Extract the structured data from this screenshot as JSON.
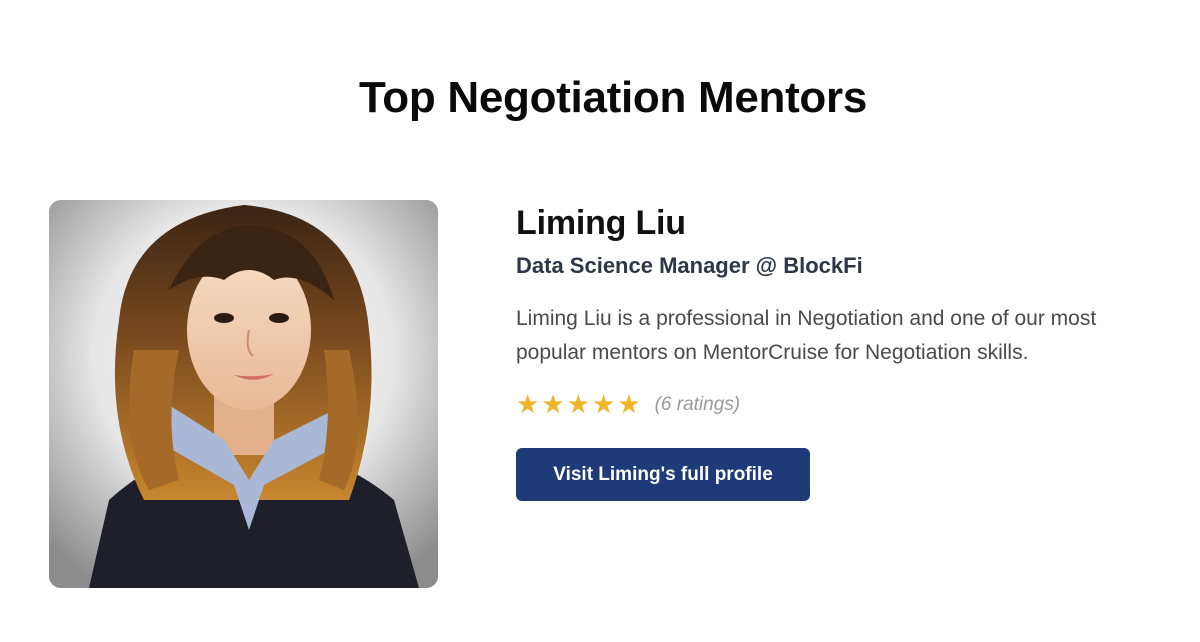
{
  "page": {
    "title": "Top Negotiation Mentors"
  },
  "mentor": {
    "name": "Liming Liu",
    "role": "Data Science Manager @ BlockFi",
    "bio": "Liming Liu is a professional in Negotiation and one of our most popular mentors on MentorCruise for Negotiation skills.",
    "rating": 5,
    "ratings_label": "(6 ratings)",
    "photo_icon": "mentor-portrait",
    "button_label": "Visit Liming's full profile"
  },
  "colors": {
    "accent_button": "#1e3a78",
    "star": "#f0b429",
    "role_text": "#2d3748"
  }
}
